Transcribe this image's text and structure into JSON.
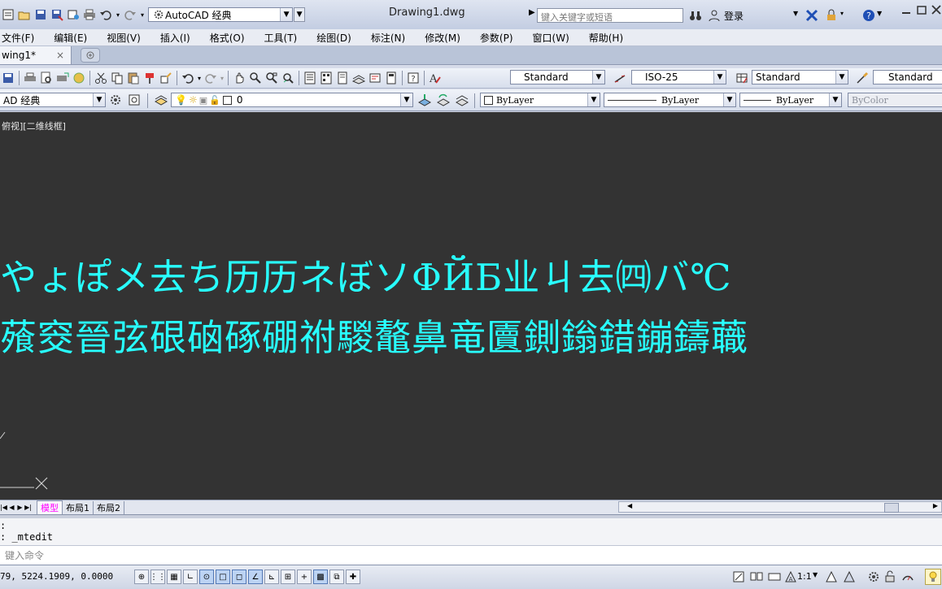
{
  "title_bar": {
    "workspace": "AutoCAD 经典",
    "document_title": "Drawing1.dwg",
    "search_placeholder": "键入关键字或短语",
    "login_label": "登录"
  },
  "menu": {
    "items": [
      "文件(F)",
      "编辑(E)",
      "视图(V)",
      "插入(I)",
      "格式(O)",
      "工具(T)",
      "绘图(D)",
      "标注(N)",
      "修改(M)",
      "参数(P)",
      "窗口(W)",
      "帮助(H)"
    ]
  },
  "doc_tabs": {
    "active": "wing1*",
    "close": "×"
  },
  "styles_toolbar": {
    "text_style": "Standard",
    "dim_style": "ISO-25",
    "table_style": "Standard",
    "multileader_style": "Standard"
  },
  "layers_toolbar": {
    "workspace": "AD 经典",
    "layer": "0",
    "color": "ByLayer",
    "linetype": "ByLayer",
    "lineweight": "ByLayer",
    "plotstyle": "ByColor"
  },
  "viewport": {
    "label": "俯视][二维线框]",
    "line1": "やょぽメ去ち历历ネぼソΦЙБ业ㄐ去㈣バ℃",
    "line2": "蕵窔晉弦硍硇硺硼祔騣鼇鼻竜匵鍘鎓錯鏰鑄蘵",
    "text_color": "#28ffff",
    "background": "#333333"
  },
  "layout_tabs": {
    "items": [
      "模型",
      "布局1",
      "布局2"
    ],
    "active": "模型",
    "active_color": "#ff00ff"
  },
  "command": {
    "prev_line": ":",
    "history": ": _mtedit",
    "input_placeholder": "键入命令"
  },
  "status": {
    "coords": "79, 5224.1909, 0.0000",
    "scale": "1:1"
  }
}
